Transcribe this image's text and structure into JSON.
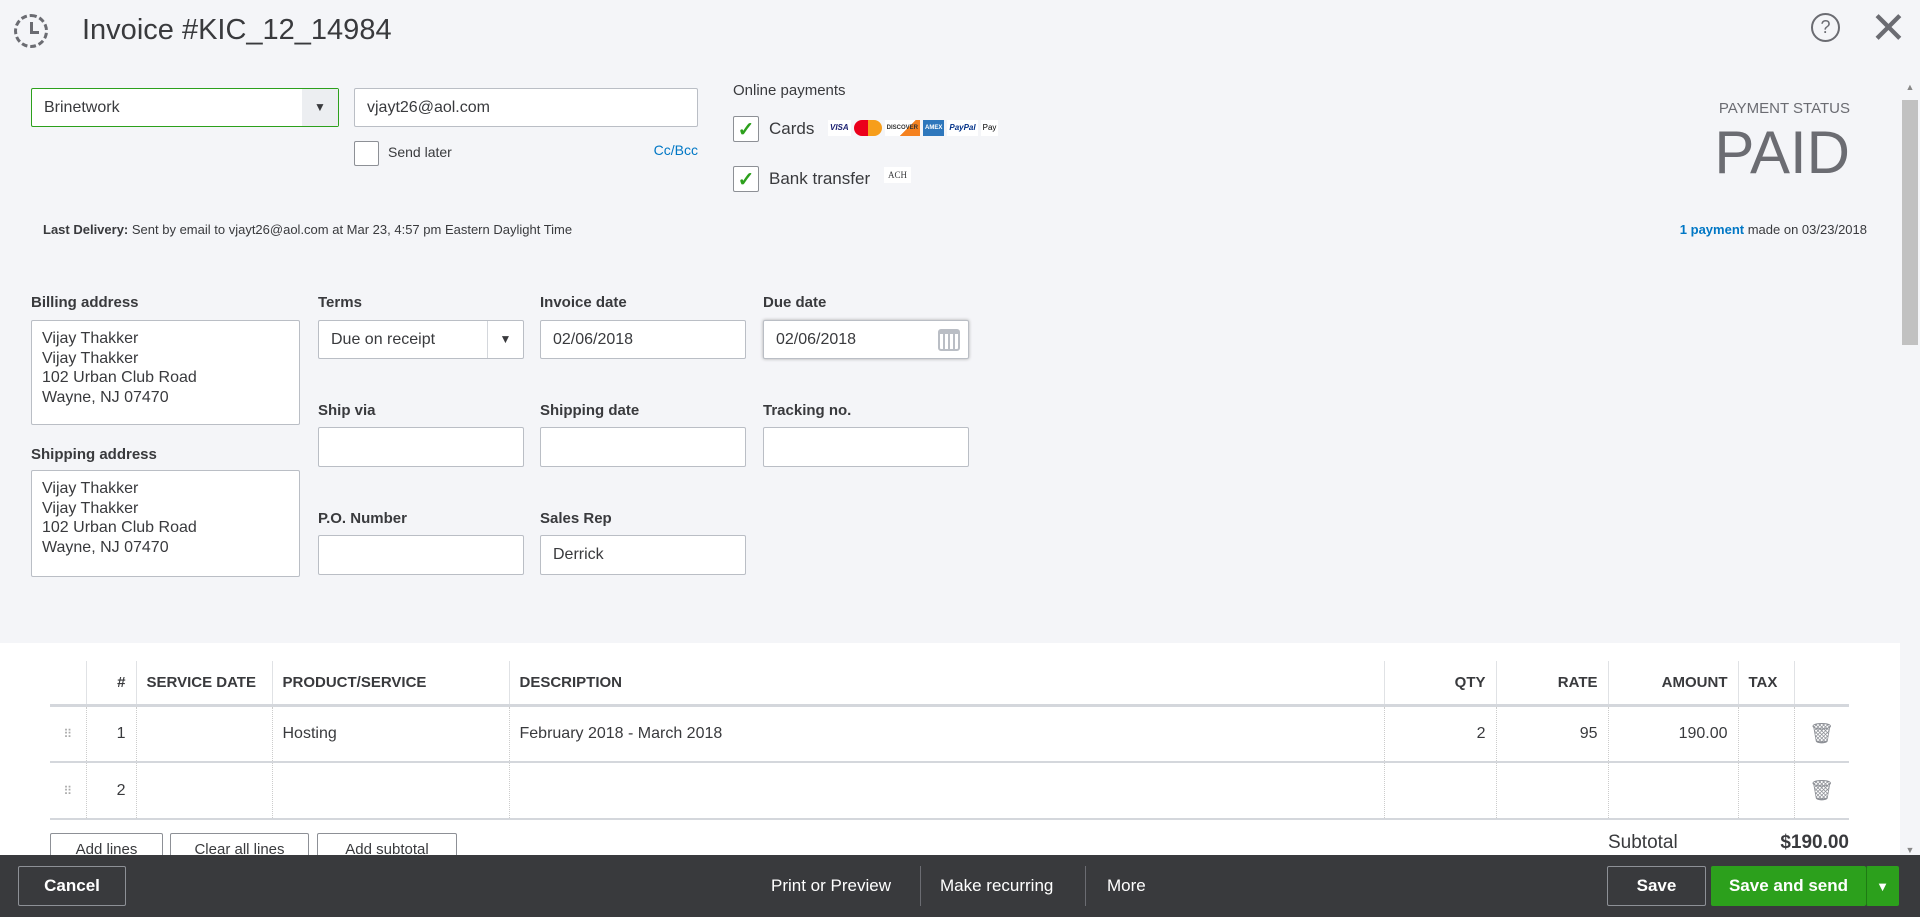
{
  "header": {
    "title": "Invoice #KIC_12_14984"
  },
  "customer": {
    "name": "Brinetwork",
    "email": "vjayt26@aol.com",
    "send_later": "Send later",
    "cc_bcc": "Cc/Bcc"
  },
  "online_payments": {
    "title": "Online payments",
    "cards": "Cards",
    "card_brands": [
      "VISA",
      "MC",
      "DISCOVER",
      "AMEX",
      "PayPal",
      "Pay"
    ],
    "bank_transfer": "Bank transfer",
    "ach": "ACH"
  },
  "payment_status": {
    "label": "PAYMENT STATUS",
    "value": "PAID",
    "link": "1 payment",
    "made_on": " made on 03/23/2018"
  },
  "last_delivery": {
    "label": "Last Delivery:",
    "text": " Sent by email to vjayt26@aol.com at Mar 23, 4:57 pm Eastern Daylight Time"
  },
  "form": {
    "billing_label": "Billing address",
    "billing": [
      "Vijay Thakker",
      "Vijay Thakker",
      "102 Urban Club Road",
      "Wayne, NJ  07470"
    ],
    "shipping_label": "Shipping address",
    "shipping": [
      "Vijay Thakker",
      "Vijay Thakker",
      "102 Urban Club Road",
      "Wayne, NJ  07470"
    ],
    "terms_label": "Terms",
    "terms": "Due on receipt",
    "invoice_date_label": "Invoice date",
    "invoice_date": "02/06/2018",
    "due_date_label": "Due date",
    "due_date": "02/06/2018",
    "ship_via_label": "Ship via",
    "shipping_date_label": "Shipping date",
    "tracking_label": "Tracking no.",
    "po_label": "P.O. Number",
    "sales_rep_label": "Sales Rep",
    "sales_rep": "Derrick"
  },
  "table": {
    "headers": [
      "#",
      "SERVICE DATE",
      "PRODUCT/SERVICE",
      "DESCRIPTION",
      "QTY",
      "RATE",
      "AMOUNT",
      "TAX"
    ],
    "rows": [
      {
        "n": "1",
        "date": "",
        "product": "Hosting",
        "desc": "February 2018 - March 2018",
        "qty": "2",
        "rate": "95",
        "amount": "190.00",
        "tax": ""
      },
      {
        "n": "2",
        "date": "",
        "product": "",
        "desc": "",
        "qty": "",
        "rate": "",
        "amount": "",
        "tax": ""
      }
    ]
  },
  "actions": {
    "add_lines": "Add lines",
    "clear_lines": "Clear all lines",
    "add_subtotal": "Add subtotal"
  },
  "subtotal": {
    "label": "Subtotal",
    "value": "$190.00"
  },
  "footer": {
    "cancel": "Cancel",
    "print": "Print or Preview",
    "recurring": "Make recurring",
    "more": "More",
    "save": "Save",
    "save_send": "Save and send"
  }
}
